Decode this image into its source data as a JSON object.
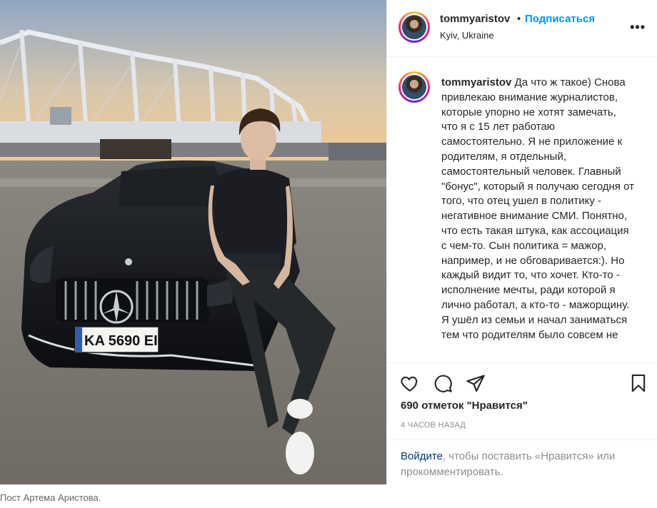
{
  "post": {
    "username": "tommyaristov",
    "follow_label": "Подписаться",
    "separator": "•",
    "location": "Kyiv, Ukraine",
    "more_label": "•••",
    "caption": {
      "username": "tommyaristov",
      "text": "Да что ж такое) Снова привлекаю внимание журналистов, которые упорно не хотят замечать, что я с 15 лет работаю самостоятельно. Я не приложение к родителям, я отдельный, самостоятельный человек. Главный \"бонус\", который я получаю сегодня от того, что отец ушел в политику - негативное внимание СМИ. Понятно, что есть такая штука, как ассоциация с чем-то. Сын политика = мажор, например, и не обговаривается:). Но каждый видит то, что хочет. Кто-то - исполнение мечты, ради которой я лично работал, а кто-то - мажорщину. Я ушёл из семьи и начал заниматься тем что родителям было совсем не"
    },
    "likes_text": "690 отметок \"Нравится\"",
    "time_text": "4 ЧАСОВ НАЗАД",
    "login_link": "Войдите",
    "login_rest": ", чтобы поставить «Нравится» или прокомментировать.",
    "icons": [
      "heart-icon",
      "comment-icon",
      "share-icon",
      "bookmark-icon"
    ],
    "photo": {
      "plate_text": "KA 5690 EI"
    }
  },
  "credit": "Пост Артема Аристова.",
  "colors": {
    "link_blue": "#0095f6",
    "text": "#262626",
    "muted": "#8e8e8e",
    "login_link": "#00376b"
  }
}
